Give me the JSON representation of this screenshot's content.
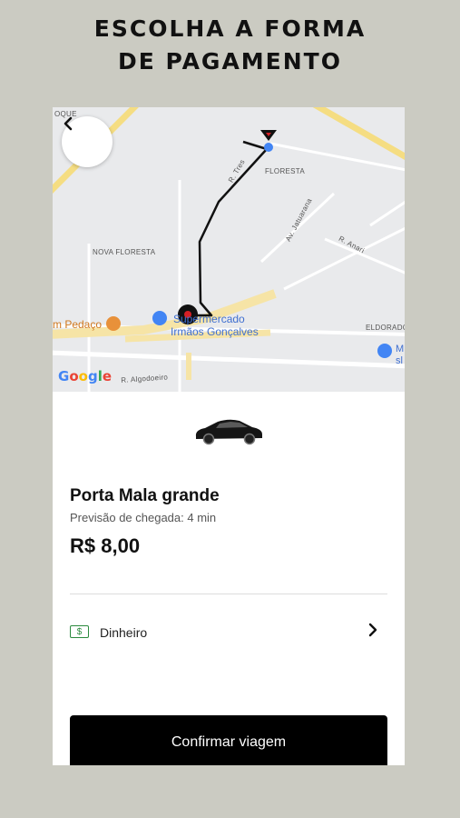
{
  "headline": {
    "line1": "ESCOLHA A FORMA",
    "line2": "DE PAGAMENTO"
  },
  "map": {
    "labels": {
      "floresta": "FLORESTA",
      "nova_floresta": "NOVA FLORESTA",
      "av_jatuarana": "Av. Jatuarana",
      "r_anari": "R. Anari",
      "r_tres": "R. Tres",
      "eldorado": "ELDORADO",
      "r_algodoeiro": "R. Algodoeiro",
      "oque": "OQUE"
    },
    "poi": {
      "supermercado_line1": "Supermercado",
      "supermercado_line2": "Irmãos Gonçalves",
      "pedaco": "m Pedaço",
      "ms_line1": "M",
      "ms_line2": "sl"
    },
    "google_logo": "Google",
    "colors": {
      "route": "#111111",
      "destination": "#d42026",
      "origin": "#4285f4"
    }
  },
  "back_icon": "chevron-left-icon",
  "ride": {
    "product": "Porta Mala grande",
    "eta": "Previsão de chegada: 4 min",
    "price": "R$ 8,00"
  },
  "payment": {
    "icon_text": "$",
    "label": "Dinheiro"
  },
  "confirm_label": "Confirmar viagem"
}
